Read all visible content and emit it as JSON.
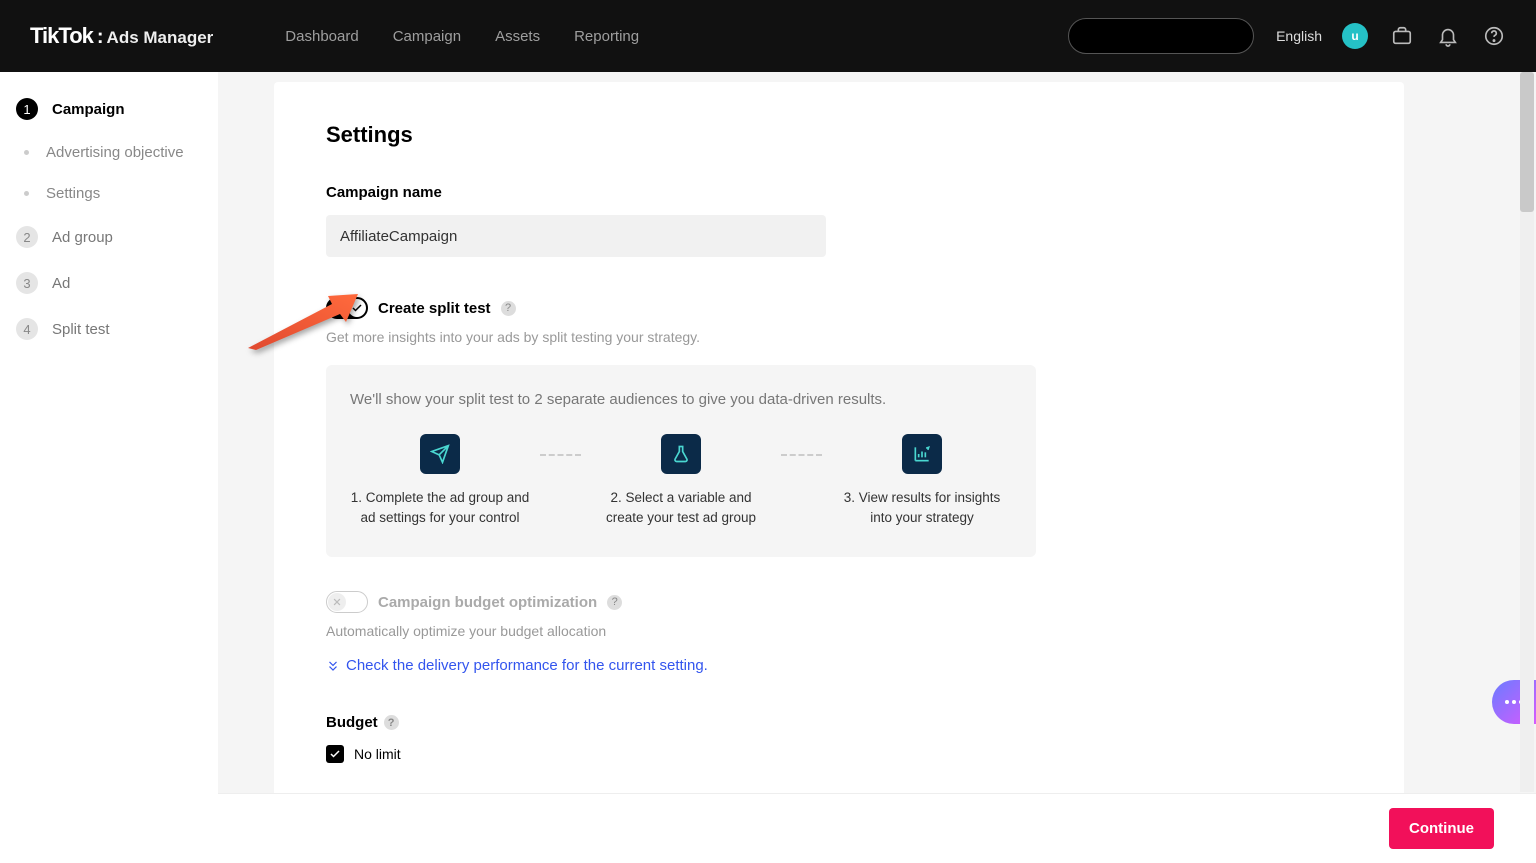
{
  "brand": {
    "name": "TikTok",
    "product": "Ads Manager"
  },
  "topnav": {
    "items": [
      "Dashboard",
      "Campaign",
      "Assets",
      "Reporting"
    ],
    "language": "English",
    "avatar_initial": "u"
  },
  "sidebar": {
    "steps": [
      {
        "num": "1",
        "label": "Campaign",
        "active": true
      },
      {
        "num": "2",
        "label": "Ad group",
        "active": false
      },
      {
        "num": "3",
        "label": "Ad",
        "active": false
      },
      {
        "num": "4",
        "label": "Split test",
        "active": false
      }
    ],
    "substeps": [
      "Advertising objective",
      "Settings"
    ]
  },
  "settings": {
    "heading": "Settings",
    "campaign_name_label": "Campaign name",
    "campaign_name_value": "AffiliateCampaign",
    "split_test": {
      "label": "Create split test",
      "enabled": true,
      "desc": "Get more insights into your ads by split testing your strategy.",
      "info_lead": "We'll show your split test to 2 separate audiences to give you data-driven results.",
      "steps": [
        "1. Complete the ad group and ad settings for your control",
        "2. Select a variable and create your test ad group",
        "3. View results for insights into your strategy"
      ]
    },
    "cbo": {
      "label": "Campaign budget optimization",
      "enabled": false,
      "desc": "Automatically optimize your budget allocation",
      "link": "Check the delivery performance for the current setting."
    },
    "budget": {
      "label": "Budget",
      "no_limit_label": "No limit",
      "no_limit_checked": true
    }
  },
  "footer": {
    "continue_label": "Continue"
  }
}
